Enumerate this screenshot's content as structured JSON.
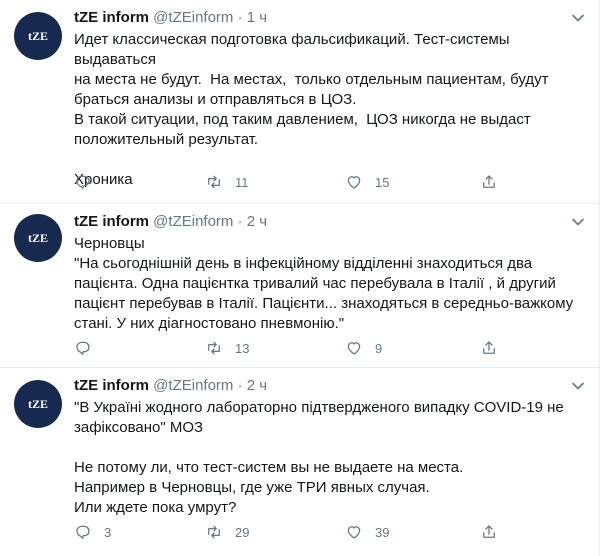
{
  "tweets": [
    {
      "avatar_text": "tZE",
      "name": "tZE inform",
      "handle": "@tZEinform",
      "separator": "·",
      "time": "1 ч",
      "lines": [
        "Идет классическая подготовка фальсификаций. Тест-системы выдаваться",
        "на места не будут.  На местах,  только отдельным пациентам, будут",
        "браться анализы и отправляться в ЦОЗ.",
        "В такой ситуации, под таким давлением,  ЦОЗ никогда не выдаст",
        "положительный результат.",
        "",
        "Хроника"
      ],
      "replies": "",
      "retweets": "11",
      "likes": "15"
    },
    {
      "avatar_text": "tZE",
      "name": "tZE inform",
      "handle": "@tZEinform",
      "separator": "·",
      "time": "2 ч",
      "lines": [
        "Черновцы",
        "\"На сьогоднішній день в інфекційному відділенні знаходиться два",
        "пацієнта. Одна пацієнтка тривалий час перебувала в Італії , й другий",
        "пацієнт перебував в Італії. Пацієнти... знаходяться в середньо-важкому",
        "стані. У них діагностовано пневмонію.\""
      ],
      "replies": "",
      "retweets": "13",
      "likes": "9"
    },
    {
      "avatar_text": "tZE",
      "name": "tZE inform",
      "handle": "@tZEinform",
      "separator": "·",
      "time": "2 ч",
      "lines": [
        "\"В Україні жодного лабораторно підтвердженого випадку COVID-19 не",
        "зафіксовано\" МОЗ",
        "",
        "Не потому ли, что тест-систем вы не выдаете на места.",
        "Например в Черновцы, где уже ТРИ явных случая.",
        "Или ждете пока умрут?"
      ],
      "replies": "3",
      "retweets": "29",
      "likes": "39"
    }
  ],
  "colors": {
    "text": "#14171a",
    "muted": "#657786",
    "border": "#e6ecf0",
    "avatar_bg": "#162a50"
  },
  "icons": [
    "reply-icon",
    "retweet-icon",
    "like-icon",
    "share-icon",
    "chevron-down-icon"
  ]
}
